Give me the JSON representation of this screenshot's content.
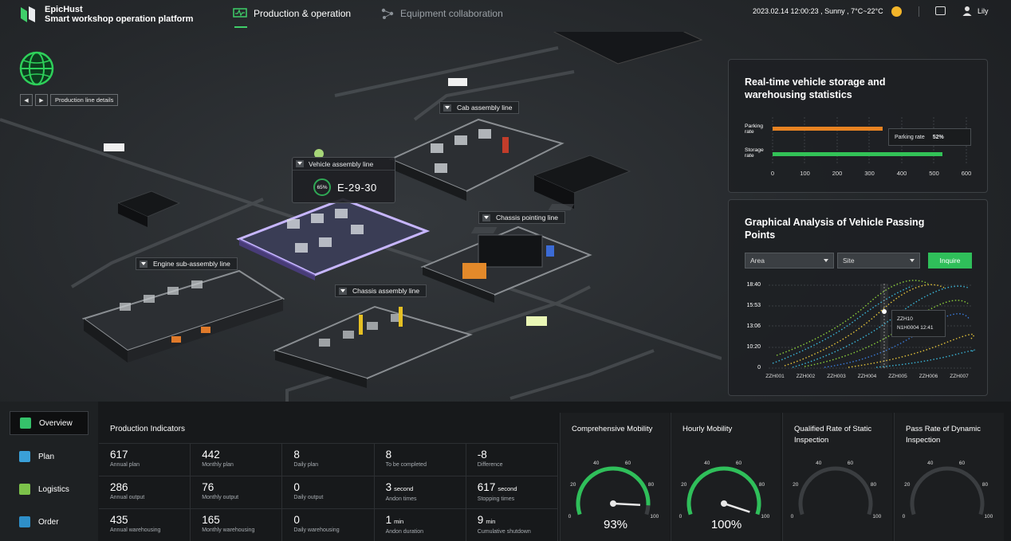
{
  "header": {
    "brand_name": "EpicHust",
    "brand_subtitle": "Smart workshop operation platform",
    "tabs": [
      {
        "label": "Production & operation",
        "active": true
      },
      {
        "label": "Equipment collaboration",
        "active": false
      }
    ],
    "status": "2023.02.14  12:00:23 , Sunny , 7°C~22°C",
    "user": "Lily"
  },
  "nav": {
    "prev_icon": "◀",
    "next_icon": "▶",
    "label": "Production line details"
  },
  "scene": {
    "lines": [
      "Cab assembly line",
      "Vehicle assembly line",
      "Chassis pointing line",
      "Engine sub-assembly line",
      "Chassis assembly line"
    ],
    "callout": {
      "progress": "65%",
      "code": "E-29-30"
    }
  },
  "storage_panel": {
    "title": "Real-time vehicle storage and warehousing statistics",
    "rows": [
      {
        "label": "Parking rate",
        "value": 340,
        "color": "#e88322"
      },
      {
        "label": "Storage rate",
        "value": 525,
        "color": "#32c257"
      }
    ],
    "tooltip": {
      "label": "Parking rate",
      "value": "52%"
    },
    "x_ticks": [
      "0",
      "100",
      "200",
      "300",
      "400",
      "500",
      "600"
    ]
  },
  "passing_panel": {
    "title": "Graphical Analysis of Vehicle Passing Points",
    "area_select": "Area",
    "site_select": "Site",
    "inquire": "Inquire",
    "y_ticks": [
      "18:40",
      "15:53",
      "13:06",
      "10:20",
      "0"
    ],
    "x_ticks": [
      "ZZH001",
      "ZZH002",
      "ZZH003",
      "ZZH004",
      "ZZH005",
      "ZZH006",
      "ZZH007"
    ],
    "tooltip": {
      "line1": "ZZH10",
      "line2": "N1H0004 12:41"
    }
  },
  "sidebar": {
    "items": [
      {
        "label": "Overview",
        "active": true,
        "color": "#35c26a"
      },
      {
        "label": "Plan",
        "active": false,
        "color": "#3aa0d8"
      },
      {
        "label": "Logistics",
        "active": false,
        "color": "#7cc24a"
      },
      {
        "label": "Order",
        "active": false,
        "color": "#2e8fc9"
      }
    ]
  },
  "indicators": {
    "title": "Production Indicators",
    "cells": [
      {
        "value": "617",
        "unit": "",
        "label": "Annual plan"
      },
      {
        "value": "442",
        "unit": "",
        "label": "Monthly plan"
      },
      {
        "value": "8",
        "unit": "",
        "label": "Daily plan"
      },
      {
        "value": "8",
        "unit": "",
        "label": "To be completed"
      },
      {
        "value": "-8",
        "unit": "",
        "label": "Difference"
      },
      {
        "value": "286",
        "unit": "",
        "label": "Annual output"
      },
      {
        "value": "76",
        "unit": "",
        "label": "Monthly output"
      },
      {
        "value": "0",
        "unit": "",
        "label": "Daily output"
      },
      {
        "value": "3",
        "unit": "second",
        "label": "Andon times"
      },
      {
        "value": "617",
        "unit": "second",
        "label": "Stopping times"
      },
      {
        "value": "435",
        "unit": "",
        "label": "Annual warehousing"
      },
      {
        "value": "165",
        "unit": "",
        "label": "Monthly warehousing"
      },
      {
        "value": "0",
        "unit": "",
        "label": "Daily warehousing"
      },
      {
        "value": "1",
        "unit": "min",
        "label": "Andon duration"
      },
      {
        "value": "9",
        "unit": "min",
        "label": "Cumulative shutdown"
      }
    ]
  },
  "gauges": [
    {
      "title": "Comprehensive Mobility",
      "value": "93%",
      "fraction": 0.93
    },
    {
      "title": "Hourly Mobility",
      "value": "100%",
      "fraction": 1.0
    },
    {
      "title": "Qualified Rate of Static Inspection",
      "value": "",
      "fraction": 0.0
    },
    {
      "title": "Pass Rate of Dynamic Inspection",
      "value": "",
      "fraction": 0.0
    }
  ],
  "gauge_ticks": [
    "0",
    "20",
    "40",
    "60",
    "80",
    "100"
  ]
}
